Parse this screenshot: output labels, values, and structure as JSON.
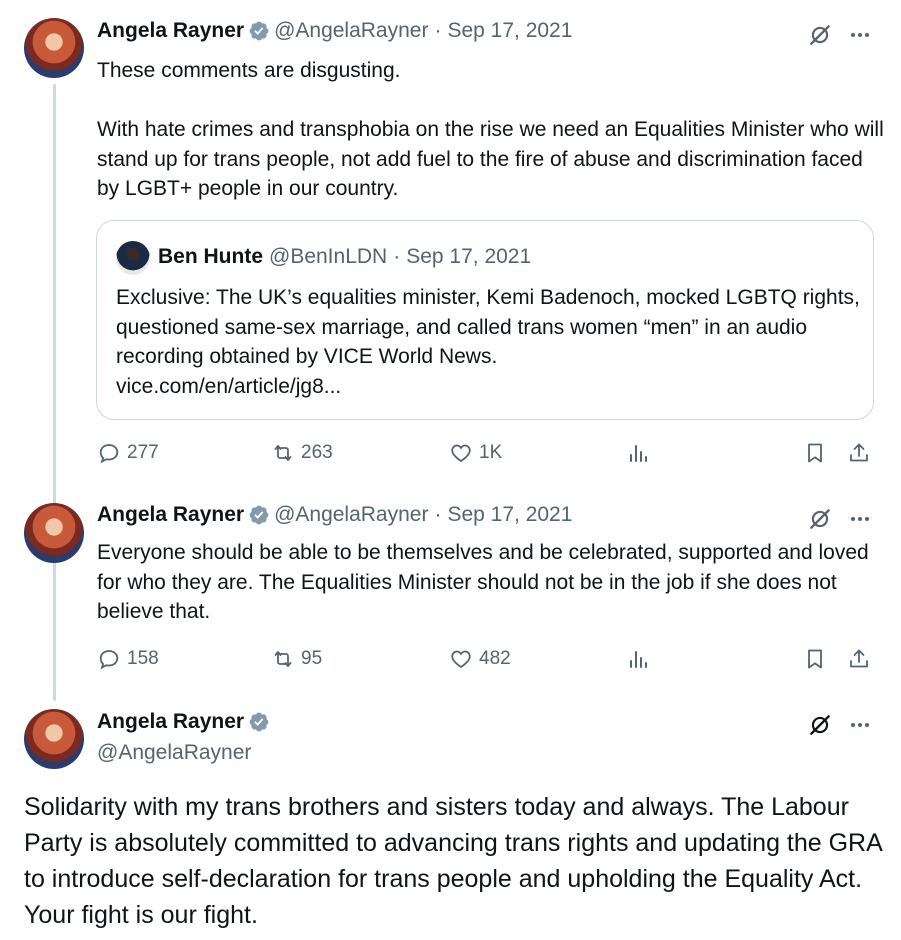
{
  "tweets": [
    {
      "author": "Angela Rayner",
      "handle": "@AngelaRayner",
      "separator": "·",
      "date": "Sep 17, 2021",
      "text": "These comments are disgusting.\n\nWith hate crimes and transphobia on the rise we need an Equalities Minister who will stand up for trans people, not add fuel to the fire of abuse and discrimination faced by LGBT+ people in our country.",
      "quote": {
        "author": "Ben Hunte",
        "handle": "@BenInLDN",
        "separator": "·",
        "date": "Sep 17, 2021",
        "text": "Exclusive: The UK’s equalities minister, Kemi Badenoch, mocked LGBTQ rights, questioned same-sex marriage, and called trans women “men” in an audio recording obtained by VICE World News.",
        "link": "vice.com/en/article/jg8..."
      },
      "replies": "277",
      "reposts": "263",
      "likes": "1K"
    },
    {
      "author": "Angela Rayner",
      "handle": "@AngelaRayner",
      "separator": "·",
      "date": "Sep 17, 2021",
      "text": "Everyone should be able to be themselves and be celebrated, supported and loved for who they are. The Equalities Minister should not be in the job if she does not believe that.",
      "replies": "158",
      "reposts": "95",
      "likes": "482"
    }
  ],
  "main_tweet": {
    "author": "Angela Rayner",
    "handle": "@AngelaRayner",
    "text": "Solidarity with my trans brothers and sisters today and always. The Labour Party is absolutely committed to advancing trans rights and updating the GRA to introduce self-declaration for trans people and upholding the Equality Act. Your fight is our fight."
  },
  "icons": {
    "verified": "verified-badge-icon",
    "grok": "grok-icon",
    "more": "more-icon",
    "reply": "reply-icon",
    "repost": "repost-icon",
    "like": "like-icon",
    "views": "views-icon",
    "bookmark": "bookmark-icon",
    "share": "share-icon"
  },
  "colors": {
    "text_primary": "#0f1419",
    "text_secondary": "#536471",
    "verified": "#829aab",
    "border": "#cfd9de"
  }
}
